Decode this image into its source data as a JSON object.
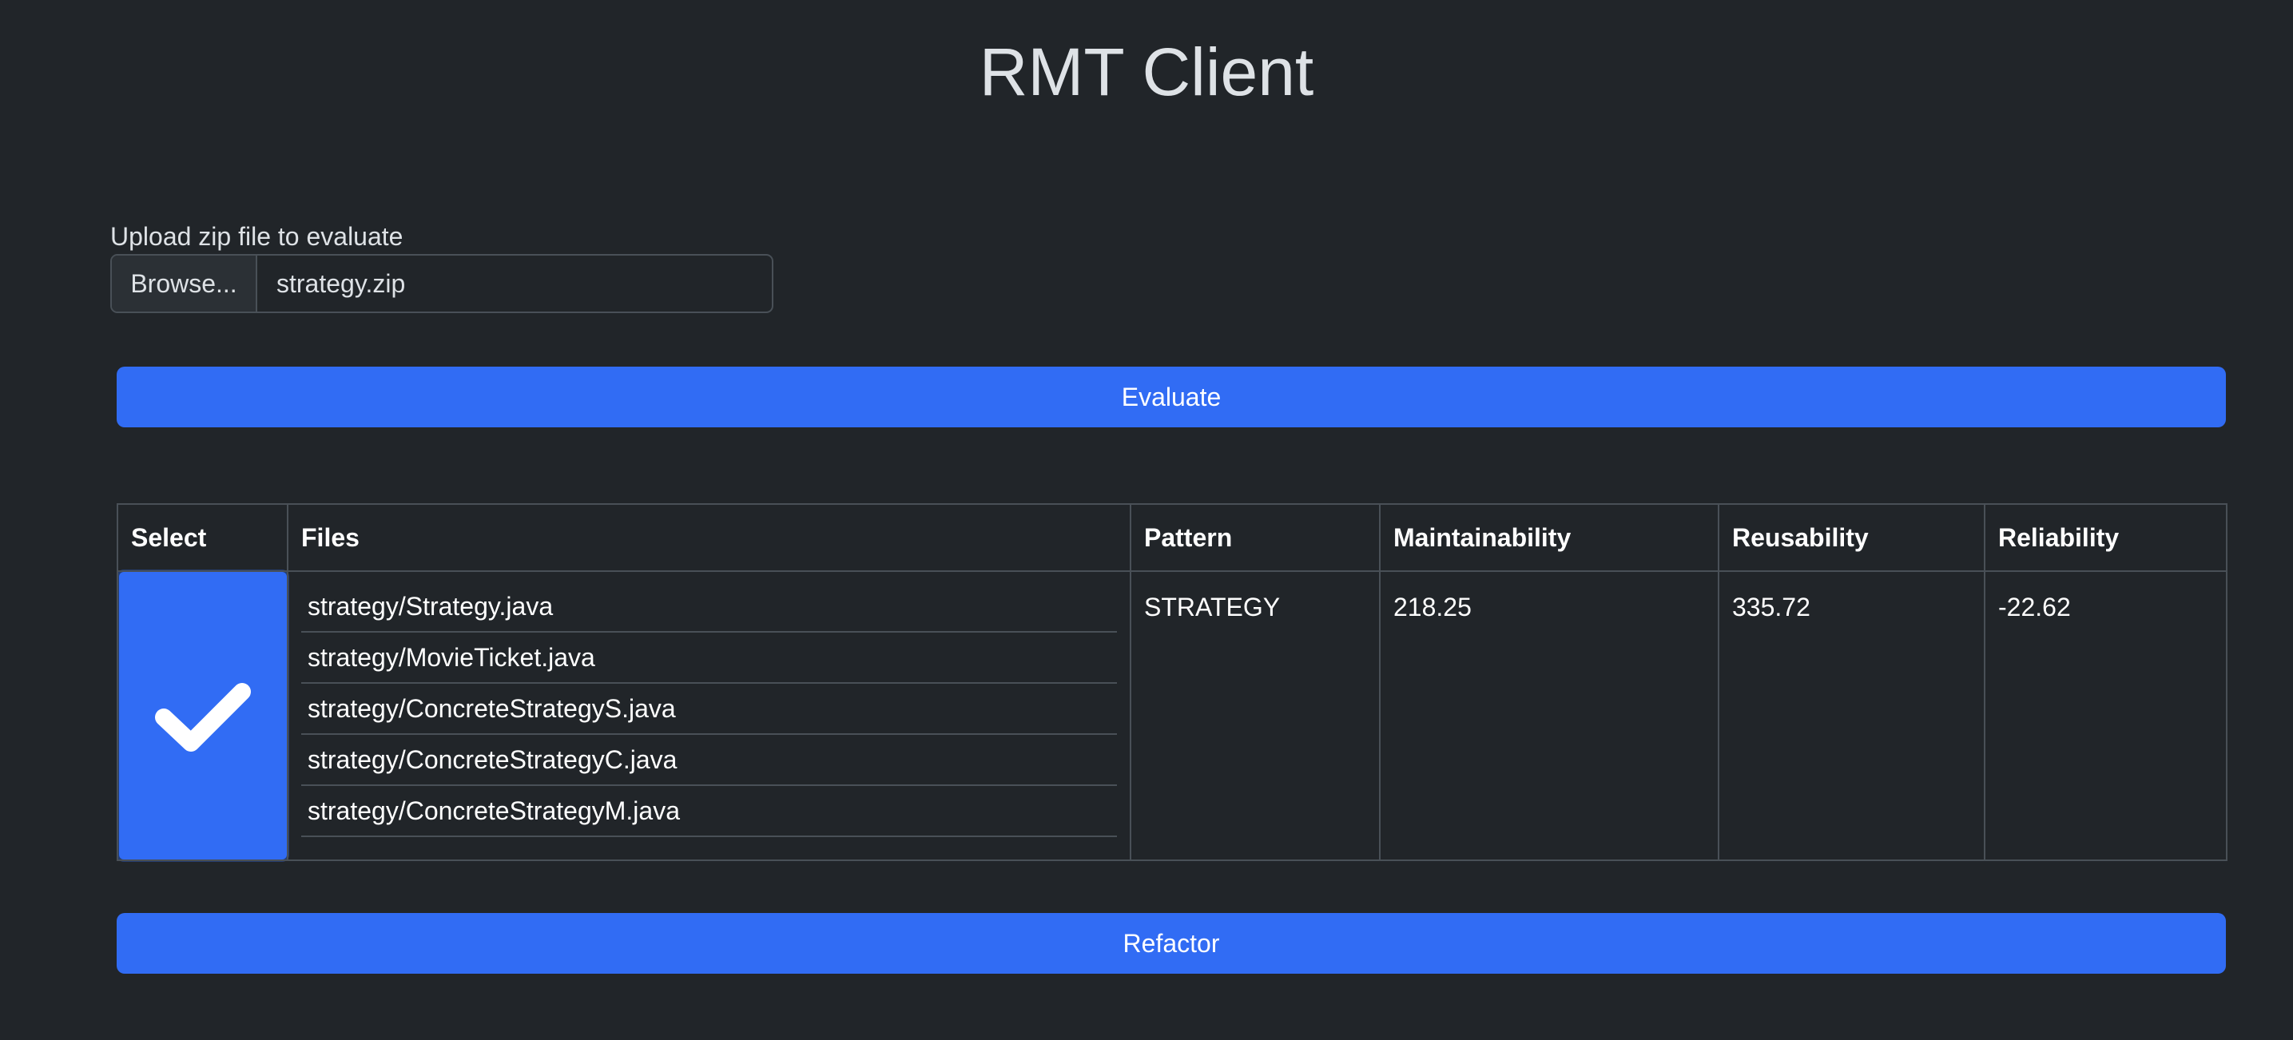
{
  "page": {
    "title": "RMT Client"
  },
  "upload": {
    "label": "Upload zip file to evaluate",
    "browse_label": "Browse...",
    "file_name": "strategy.zip"
  },
  "actions": {
    "evaluate_label": "Evaluate",
    "refactor_label": "Refactor"
  },
  "table": {
    "headers": {
      "select": "Select",
      "files": "Files",
      "pattern": "Pattern",
      "maintainability": "Maintainability",
      "reusability": "Reusability",
      "reliability": "Reliability"
    },
    "rows": [
      {
        "selected": true,
        "files": [
          "strategy/Strategy.java",
          "strategy/MovieTicket.java",
          "strategy/ConcreteStrategyS.java",
          "strategy/ConcreteStrategyC.java",
          "strategy/ConcreteStrategyM.java"
        ],
        "pattern": "STRATEGY",
        "maintainability": "218.25",
        "reusability": "335.72",
        "reliability": "-22.62"
      }
    ]
  },
  "icons": {
    "checkbox": "checkmark-icon"
  },
  "colors": {
    "background": "#212529",
    "primary": "#316cf4",
    "border": "#495057",
    "text": "#dee2e6"
  }
}
